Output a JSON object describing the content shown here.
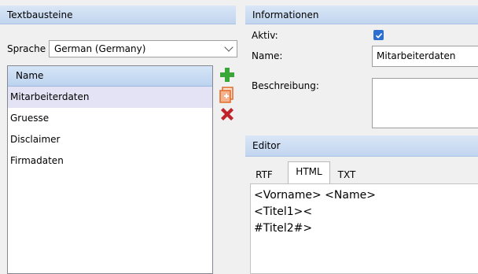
{
  "left_panel": {
    "title": "Textbausteine",
    "language_label": "Sprache",
    "language_value": "German (Germany)",
    "list_header": "Name",
    "items": [
      "Mitarbeiterdaten",
      "Gruesse",
      "Disclaimer",
      "Firmadaten"
    ],
    "selected_index": 0
  },
  "toolbar": {
    "add_icon": "plus-icon",
    "copy_icon": "copy-icon",
    "delete_icon": "delete-x-icon",
    "colors": {
      "add": "#3aa63a",
      "copy": "#e06a2b",
      "delete": "#c0242b"
    }
  },
  "info_panel": {
    "title": "Informationen",
    "active_label": "Aktiv:",
    "active_checked": true,
    "name_label": "Name:",
    "name_value": "Mitarbeiterdaten",
    "description_label": "Beschreibung:",
    "description_value": ""
  },
  "editor_panel": {
    "title": "Editor",
    "tabs": [
      "RTF",
      "HTML",
      "TXT"
    ],
    "active_tab": "HTML",
    "lines": [
      "<Vorname> <Name>",
      "<Titel1><",
      "#Titel2#>"
    ]
  },
  "colors": {
    "accent": "#2c6fd1",
    "header_bg": "#c8d9f0",
    "selection": "#e3e3f5"
  }
}
